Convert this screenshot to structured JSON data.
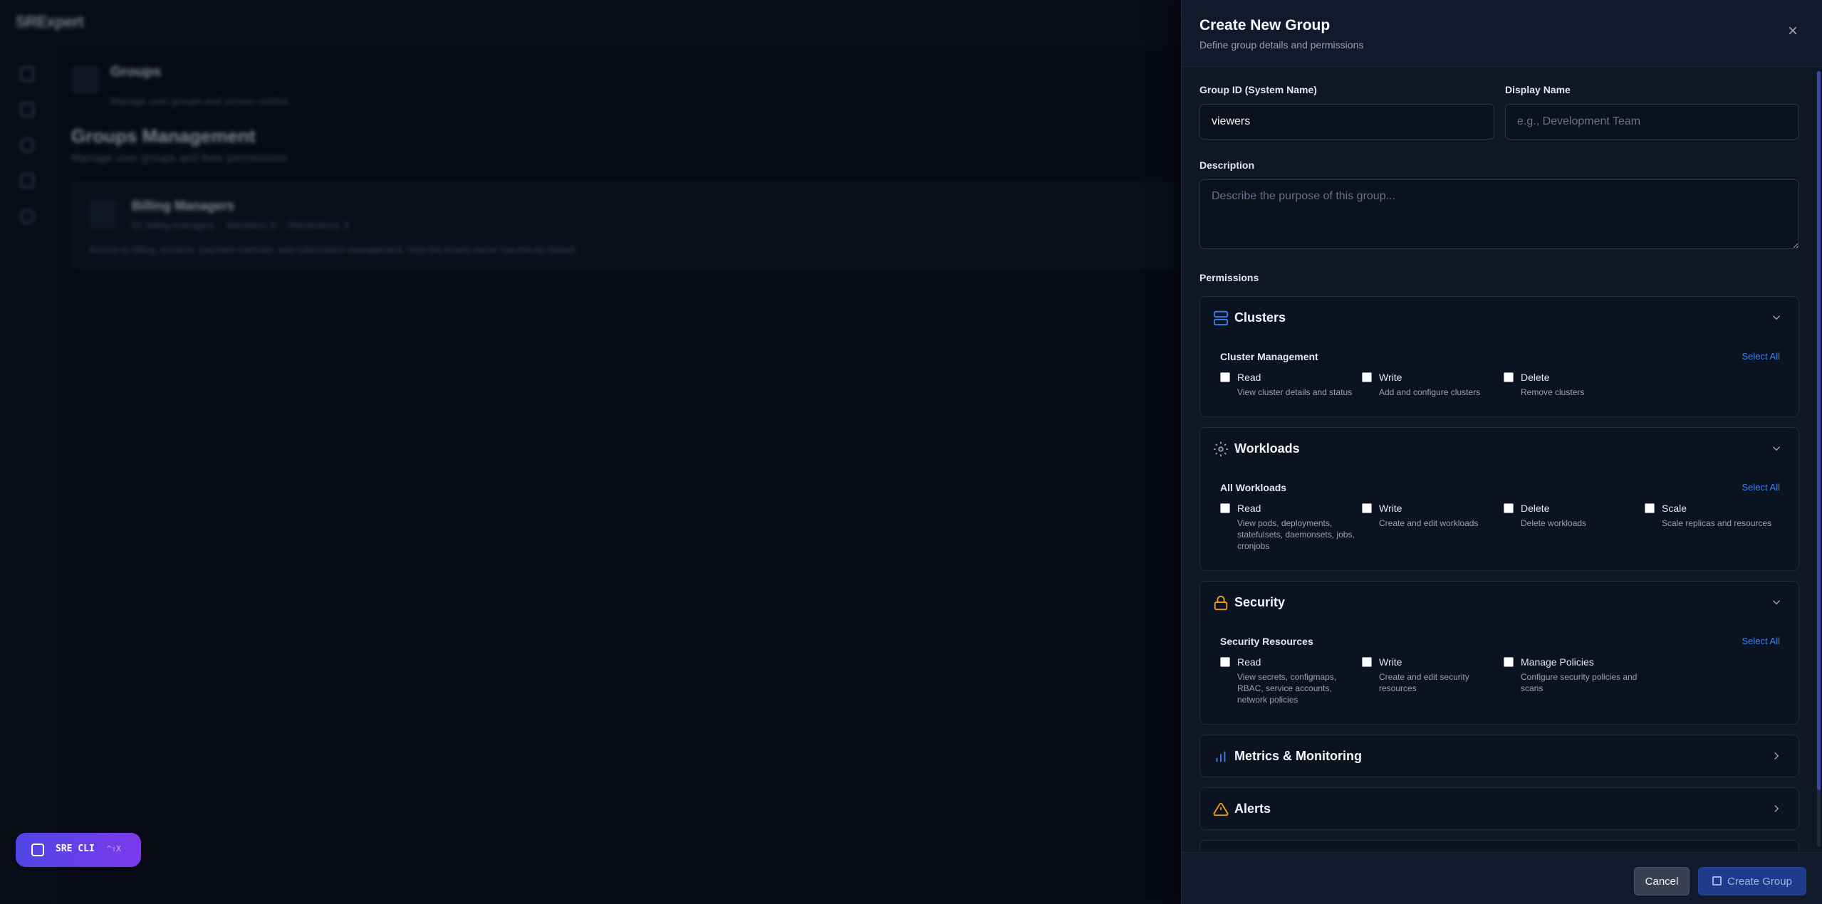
{
  "app": {
    "logo": "SRExpert",
    "page_header": {
      "title": "Groups",
      "subtitle": "Manage user groups and access control"
    },
    "management": {
      "title": "Groups Management",
      "subtitle": "Manage user groups and their permissions"
    },
    "group_card": {
      "name": "Billing Managers",
      "id_text": "ID: billing-managers",
      "members_text": "Members: 0",
      "permissions_text": "Permissions: 3",
      "description": "Access to billing, invoices, payment methods, and subscription management. Only the tenant owner has this by default."
    },
    "cli": {
      "label": "SRE CLI",
      "shortcut": "^⇧X"
    }
  },
  "drawer": {
    "title": "Create New Group",
    "subtitle": "Define group details and permissions",
    "group_id": {
      "label": "Group ID (System Name)",
      "value": "viewers"
    },
    "display_name": {
      "label": "Display Name",
      "placeholder": "e.g., Development Team"
    },
    "description": {
      "label": "Description",
      "placeholder": "Describe the purpose of this group..."
    },
    "permissions_label": "Permissions",
    "sections": {
      "clusters": {
        "title": "Clusters",
        "subtitle": "Cluster Management",
        "select_all": "Select All",
        "perms": [
          {
            "name": "Read",
            "desc": "View cluster details and status"
          },
          {
            "name": "Write",
            "desc": "Add and configure clusters"
          },
          {
            "name": "Delete",
            "desc": "Remove clusters"
          }
        ]
      },
      "workloads": {
        "title": "Workloads",
        "subtitle": "All Workloads",
        "select_all": "Select All",
        "perms": [
          {
            "name": "Read",
            "desc": "View pods, deployments, statefulsets, daemonsets, jobs, cronjobs"
          },
          {
            "name": "Write",
            "desc": "Create and edit workloads"
          },
          {
            "name": "Delete",
            "desc": "Delete workloads"
          },
          {
            "name": "Scale",
            "desc": "Scale replicas and resources"
          }
        ]
      },
      "security": {
        "title": "Security",
        "subtitle": "Security Resources",
        "select_all": "Select All",
        "perms": [
          {
            "name": "Read",
            "desc": "View secrets, configmaps, RBAC, service accounts, network policies"
          },
          {
            "name": "Write",
            "desc": "Create and edit security resources"
          },
          {
            "name": "Manage Policies",
            "desc": "Configure security policies and scans"
          }
        ]
      },
      "metrics": {
        "title": "Metrics & Monitoring"
      },
      "alerts": {
        "title": "Alerts"
      }
    },
    "footer": {
      "cancel": "Cancel",
      "create": "Create Group"
    }
  },
  "colors": {
    "accent_blue": "#3b82f6",
    "security_orange": "#f59e0b",
    "alerts_orange": "#f59e0b",
    "drawer_bg": "#0f1624"
  }
}
